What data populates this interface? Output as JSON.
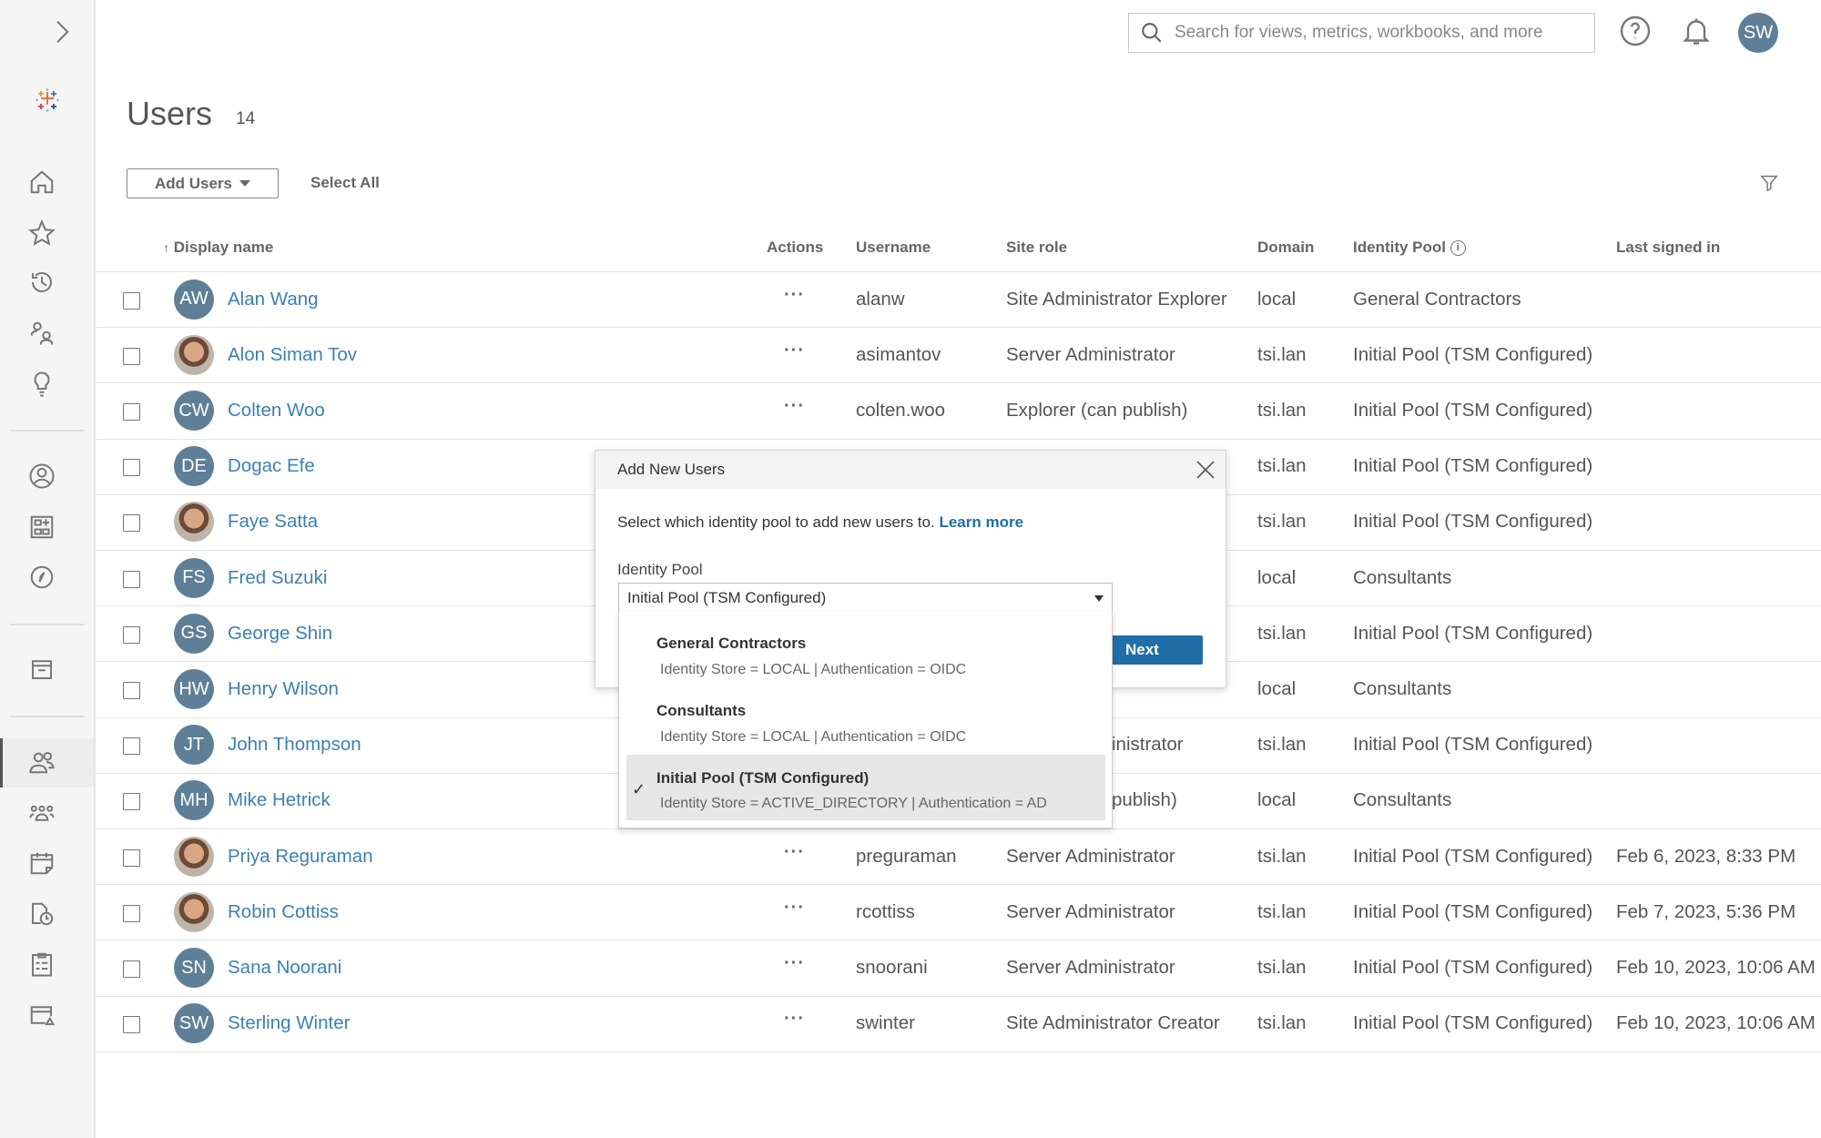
{
  "search": {
    "placeholder": "Search for views, metrics, workbooks, and more"
  },
  "user_avatar": "SW",
  "page": {
    "title": "Users",
    "count": "14"
  },
  "toolbar": {
    "add_users": "Add Users",
    "select_all": "Select All"
  },
  "columns": {
    "display_name": "Display name",
    "actions": "Actions",
    "username": "Username",
    "site_role": "Site role",
    "domain": "Domain",
    "identity_pool": "Identity Pool",
    "last_signed_in": "Last signed in"
  },
  "users": [
    {
      "initials": "AW",
      "name": "Alan Wang",
      "username": "alanw",
      "site_role": "Site Administrator Explorer",
      "domain": "local",
      "pool": "General Contractors",
      "last": ""
    },
    {
      "initials": "",
      "photo": true,
      "name": "Alon Siman Tov",
      "username": "asimantov",
      "site_role": "Server Administrator",
      "domain": "tsi.lan",
      "pool": "Initial Pool (TSM Configured)",
      "last": ""
    },
    {
      "initials": "CW",
      "name": "Colten Woo",
      "username": "colten.woo",
      "site_role": "Explorer (can publish)",
      "domain": "tsi.lan",
      "pool": "Initial Pool (TSM Configured)",
      "last": ""
    },
    {
      "initials": "DE",
      "name": "Dogac Efe",
      "username": "",
      "site_role": "",
      "domain": "tsi.lan",
      "pool": "Initial Pool (TSM Configured)",
      "last": ""
    },
    {
      "initials": "",
      "photo": true,
      "name": "Faye Satta",
      "username": "",
      "site_role": "",
      "domain": "tsi.lan",
      "pool": "Initial Pool (TSM Configured)",
      "last": ""
    },
    {
      "initials": "FS",
      "name": "Fred Suzuki",
      "username": "",
      "site_role": "",
      "domain": "local",
      "pool": "Consultants",
      "last": ""
    },
    {
      "initials": "GS",
      "name": "George Shin",
      "username": "",
      "site_role": "",
      "domain": "tsi.lan",
      "pool": "Initial Pool (TSM Configured)",
      "last": ""
    },
    {
      "initials": "HW",
      "name": "Henry Wilson",
      "username": "",
      "site_role": "",
      "domain": "local",
      "pool": "Consultants",
      "last": ""
    },
    {
      "initials": "JT",
      "name": "John Thompson",
      "username": "",
      "site_role": "inistrator",
      "domain": "tsi.lan",
      "pool": "Initial Pool (TSM Configured)",
      "last": ""
    },
    {
      "initials": "MH",
      "name": "Mike Hetrick",
      "username": "",
      "site_role": "publish)",
      "domain": "local",
      "pool": "Consultants",
      "last": ""
    },
    {
      "initials": "",
      "photo": true,
      "name": "Priya Reguraman",
      "username": "preguraman",
      "site_role": "Server Administrator",
      "domain": "tsi.lan",
      "pool": "Initial Pool (TSM Configured)",
      "last": "Feb 6, 2023, 8:33 PM"
    },
    {
      "initials": "",
      "photo": true,
      "name": "Robin Cottiss",
      "username": "rcottiss",
      "site_role": "Server Administrator",
      "domain": "tsi.lan",
      "pool": "Initial Pool (TSM Configured)",
      "last": "Feb 7, 2023, 5:36 PM"
    },
    {
      "initials": "SN",
      "name": "Sana Noorani",
      "username": "snoorani",
      "site_role": "Server Administrator",
      "domain": "tsi.lan",
      "pool": "Initial Pool (TSM Configured)",
      "last": "Feb 10, 2023, 10:06 AM"
    },
    {
      "initials": "SW",
      "name": "Sterling Winter",
      "username": "swinter",
      "site_role": "Site Administrator Creator",
      "domain": "tsi.lan",
      "pool": "Initial Pool (TSM Configured)",
      "last": "Feb 10, 2023, 10:06 AM"
    }
  ],
  "dialog": {
    "title": "Add New Users",
    "text": "Select which identity pool to add new users to.",
    "learn_more": "Learn more",
    "label": "Identity Pool",
    "selected": "Initial Pool (TSM Configured)",
    "next": "Next",
    "options": [
      {
        "title": "General Contractors",
        "sub": "Identity Store = LOCAL | Authentication = OIDC"
      },
      {
        "title": "Consultants",
        "sub": "Identity Store = LOCAL | Authentication = OIDC"
      },
      {
        "title": "Initial Pool (TSM Configured)",
        "sub": "Identity Store = ACTIVE_DIRECTORY | Authentication = AD"
      }
    ]
  },
  "colors": {
    "accent": "#1f6ea7",
    "link": "#3d7fb3",
    "avatar": "#5f7f97"
  }
}
